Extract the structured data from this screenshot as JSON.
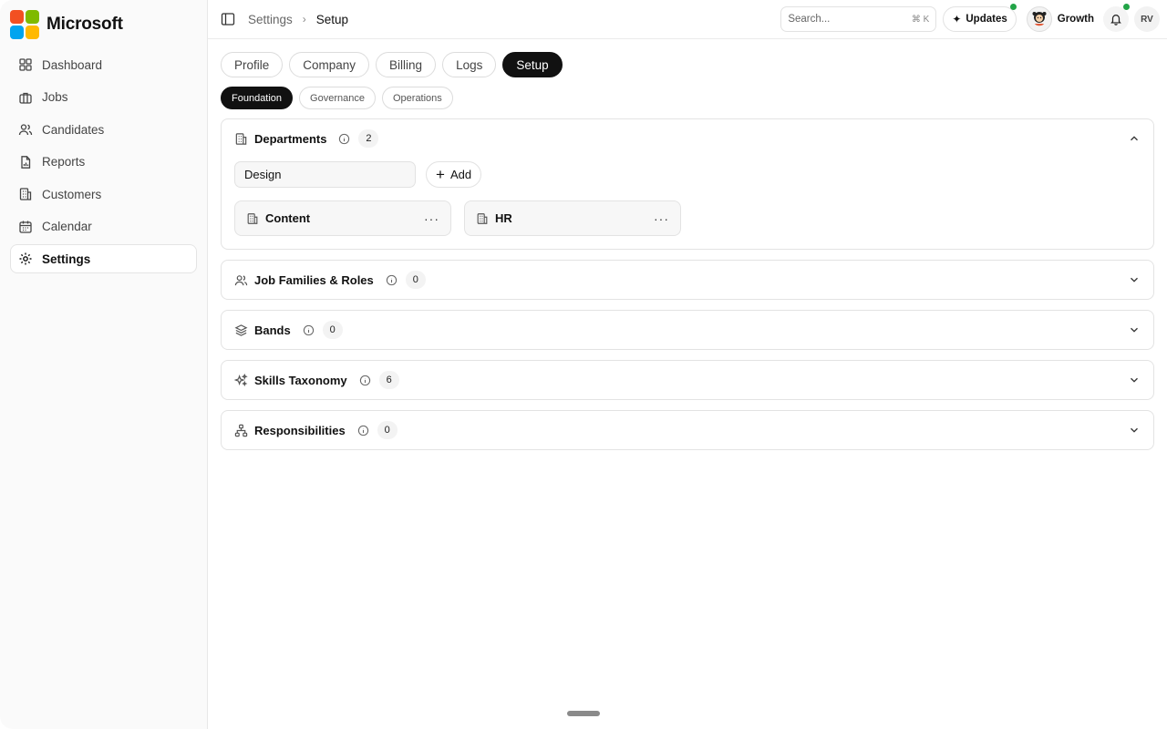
{
  "brand": {
    "name": "Microsoft",
    "colors": [
      "#f25022",
      "#7fba00",
      "#00a4ef",
      "#ffb900"
    ]
  },
  "sidebar": {
    "items": [
      {
        "label": "Dashboard",
        "icon": "dashboard-icon"
      },
      {
        "label": "Jobs",
        "icon": "briefcase-icon"
      },
      {
        "label": "Candidates",
        "icon": "users-icon"
      },
      {
        "label": "Reports",
        "icon": "report-icon"
      },
      {
        "label": "Customers",
        "icon": "building-icon"
      },
      {
        "label": "Calendar",
        "icon": "calendar-icon"
      },
      {
        "label": "Settings",
        "icon": "gear-icon",
        "active": true
      }
    ]
  },
  "topbar": {
    "breadcrumb": [
      "Settings",
      "Setup"
    ],
    "search_placeholder": "Search...",
    "search_shortcut": "⌘ K",
    "updates_label": "Updates",
    "workspace_name": "Growth",
    "user_initials": "RV",
    "status_color": "#22a447"
  },
  "tabs": [
    "Profile",
    "Company",
    "Billing",
    "Logs",
    "Setup"
  ],
  "active_tab": "Setup",
  "subtabs": [
    "Foundation",
    "Governance",
    "Operations"
  ],
  "active_subtab": "Foundation",
  "sections": {
    "departments": {
      "title": "Departments",
      "count": "2",
      "input_value": "Design",
      "add_label": "Add",
      "items": [
        "Content",
        "HR"
      ]
    },
    "job_families": {
      "title": "Job Families & Roles",
      "count": "0"
    },
    "bands": {
      "title": "Bands",
      "count": "0"
    },
    "skills": {
      "title": "Skills Taxonomy",
      "count": "6"
    },
    "responsibilities": {
      "title": "Responsibilities",
      "count": "0"
    }
  }
}
